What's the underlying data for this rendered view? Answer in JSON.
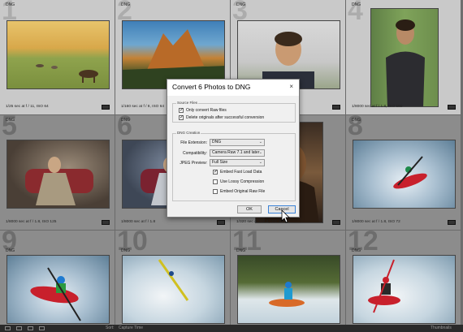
{
  "grid": {
    "cells": [
      {
        "num": "1",
        "badge": "DNG",
        "meta": "1/25 sec at f / 11, ISO 64"
      },
      {
        "num": "2",
        "badge": "DNG",
        "meta": "1/160 sec at f / 8, ISO 64"
      },
      {
        "num": "3",
        "badge": "DNG",
        "meta": ""
      },
      {
        "num": "4",
        "badge": "DNG",
        "meta": "1/8000 sec at f / 1.8, ISO 560"
      },
      {
        "num": "5",
        "badge": "DNG",
        "meta": "1/8000 sec at f / 1.8, ISO 125"
      },
      {
        "num": "6",
        "badge": "DNG",
        "meta": "1/8000 sec at f / 1.8"
      },
      {
        "num": "7",
        "badge": "",
        "meta": "1/320 sec at f / 2.8, ISO 400"
      },
      {
        "num": "8",
        "badge": "DNG",
        "meta": "1/8000 sec at f / 1.8, ISO 72"
      },
      {
        "num": "9",
        "badge": "DNG",
        "meta": ""
      },
      {
        "num": "10",
        "badge": "DNG",
        "meta": ""
      },
      {
        "num": "11",
        "badge": "DNG",
        "meta": ""
      },
      {
        "num": "12",
        "badge": "DNG",
        "meta": ""
      }
    ]
  },
  "dialog": {
    "title": "Convert 6 Photos to DNG",
    "close_glyph": "×",
    "source_files": {
      "title": "Source Files",
      "only_raw_label": "Only convert Raw files",
      "only_raw_checked": true,
      "delete_label": "Delete originals after successful conversion",
      "delete_checked": true
    },
    "dng_creation": {
      "title": "DNG Creation",
      "file_extension_label": "File Extension:",
      "file_extension_value": "DNG",
      "compatibility_label": "Compatibility:",
      "compatibility_value": "Camera Raw 7.1 and later",
      "jpeg_preview_label": "JPEG Preview:",
      "jpeg_preview_value": "Full Size",
      "embed_fast_label": "Embed Fast Load Data",
      "embed_fast_checked": true,
      "lossy_label": "Use Lossy Compression",
      "lossy_checked": false,
      "embed_raw_label": "Embed Original Raw File",
      "embed_raw_checked": false
    },
    "ok_label": "OK",
    "cancel_label": "Cancel"
  },
  "bottombar": {
    "sort_label": "Sort:",
    "sort_value": "Capture Time",
    "thumbnails_label": "Thumbnails"
  }
}
